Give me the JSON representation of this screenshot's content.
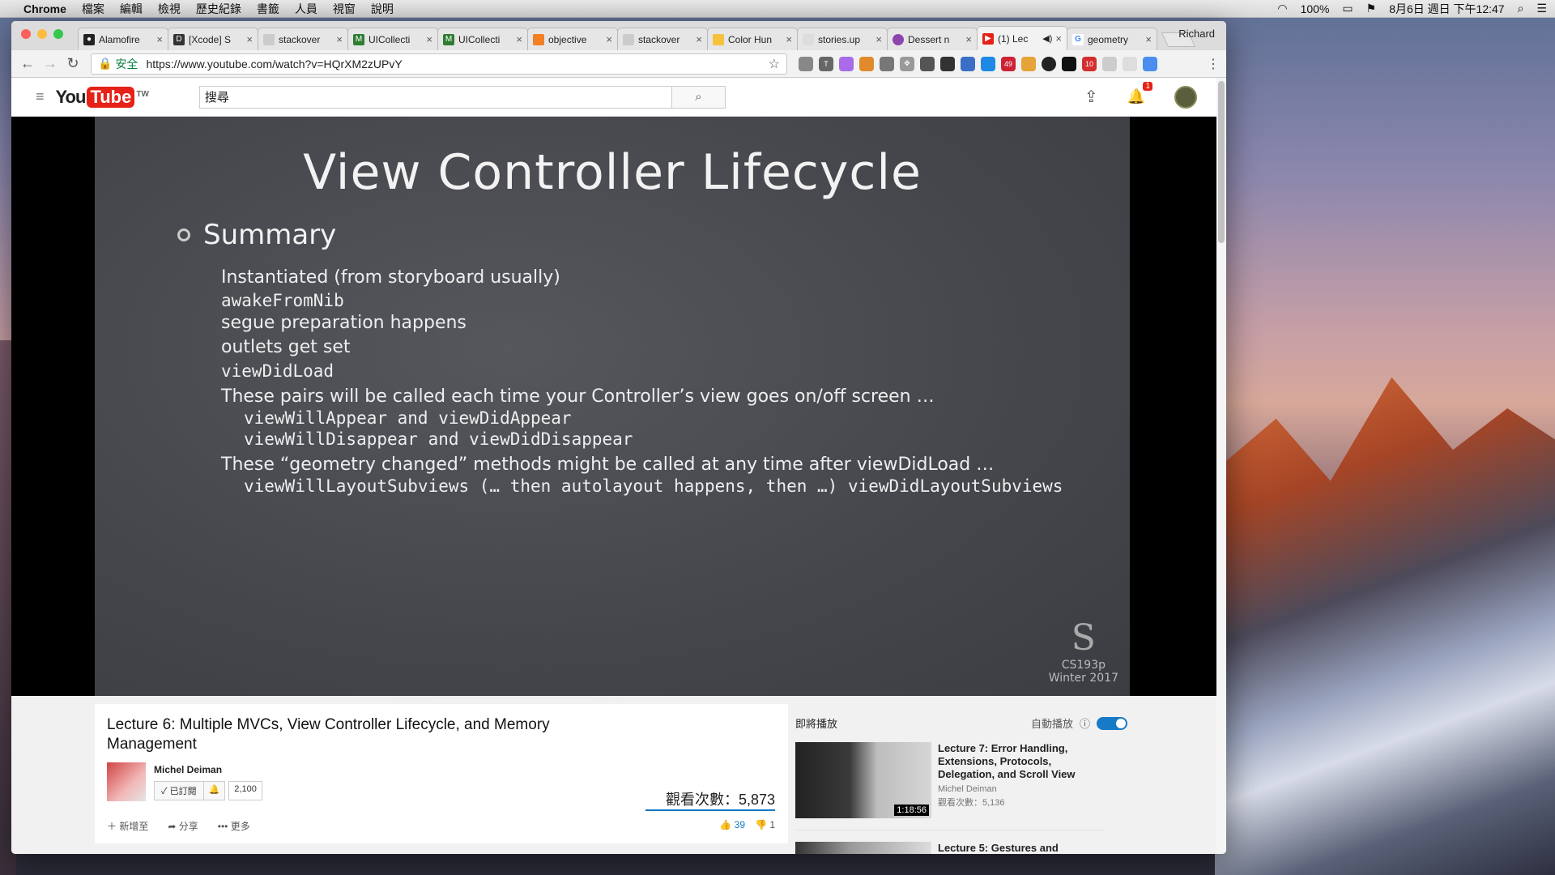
{
  "menubar": {
    "app": "Chrome",
    "items": [
      "檔案",
      "編輯",
      "檢視",
      "歷史紀錄",
      "書籤",
      "人員",
      "視窗",
      "說明"
    ],
    "battery": "100%",
    "datetime": "8月6日 週日 下午12:47"
  },
  "browser": {
    "user": "Richard",
    "tabs": [
      {
        "title": "Alamofire",
        "icon": "github-icon"
      },
      {
        "title": "[Xcode] S",
        "icon": "doc-icon"
      },
      {
        "title": "stackover",
        "icon": "stack-icon"
      },
      {
        "title": "UICollecti",
        "icon": "app-icon"
      },
      {
        "title": "UICollecti",
        "icon": "app-icon"
      },
      {
        "title": "objective",
        "icon": "stack-icon"
      },
      {
        "title": "stackover",
        "icon": "stack-icon"
      },
      {
        "title": "Color Hun",
        "icon": "palette-icon"
      },
      {
        "title": "stories.up",
        "icon": "doc-icon"
      },
      {
        "title": "Dessert n",
        "icon": "dribbble-icon"
      },
      {
        "title": "(1) Lec",
        "icon": "youtube-icon"
      },
      {
        "title": "geometry",
        "icon": "google-icon"
      }
    ],
    "secure_label": "安全",
    "url": "https://www.youtube.com/watch?v=HQrXM2zUPvY",
    "ext_badges": [
      "49",
      "10"
    ]
  },
  "youtube": {
    "logo_you": "You",
    "logo_tube": "Tube",
    "region": "TW",
    "search_placeholder": "搜尋",
    "notif_count": "1",
    "video": {
      "title": "Lecture 6: Multiple MVCs, View Controller Lifecycle, and Memory Management",
      "channel": "Michel Deiman",
      "subscribed_label": "已訂閱",
      "sub_count": "2,100",
      "views": "觀看次數：5,873",
      "add_label": "新增至",
      "share_label": "分享",
      "more_label": "更多",
      "likes": "39",
      "dislikes": "1"
    },
    "slide": {
      "title": "View Controller Lifecycle",
      "heading": "Summary",
      "lines": [
        "Instantiated (from storyboard usually)",
        "awakeFromNib",
        "segue preparation happens",
        "outlets get set",
        "viewDidLoad",
        "These pairs will be called each time your Controller’s view goes on/off screen …",
        "viewWillAppear and viewDidAppear",
        "viewWillDisappear and viewDidDisappear",
        "These “geometry changed” methods might be called at any time after viewDidLoad …",
        "viewWillLayoutSubviews (… then autolayout happens, then …) viewDidLayoutSubviews"
      ],
      "course": "CS193p",
      "term": "Winter 2017"
    },
    "sidebar": {
      "up_next": "即將播放",
      "autoplay": "自動播放",
      "recs": [
        {
          "title": "Lecture 7: Error Handling, Extensions, Protocols, Delegation, and Scroll View",
          "channel": "Michel Deiman",
          "views": "觀看次數：5,136",
          "duration": "1:18:56"
        },
        {
          "title": "Lecture 5: Gestures and"
        }
      ]
    }
  }
}
